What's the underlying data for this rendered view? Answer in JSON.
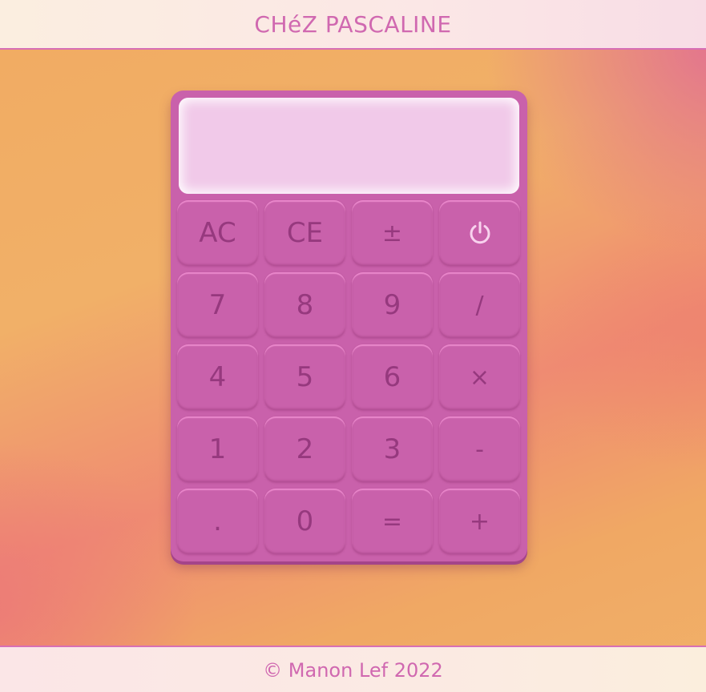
{
  "header": {
    "title": "CHéZ PASCALINE"
  },
  "calculator": {
    "display": "",
    "keys": [
      {
        "label": "AC",
        "name": "all-clear-button"
      },
      {
        "label": "CE",
        "name": "clear-entry-button"
      },
      {
        "label": "±",
        "name": "plus-minus-button"
      },
      {
        "label": "",
        "name": "power-button",
        "icon": "power-icon"
      },
      {
        "label": "7",
        "name": "digit-7-button"
      },
      {
        "label": "8",
        "name": "digit-8-button"
      },
      {
        "label": "9",
        "name": "digit-9-button"
      },
      {
        "label": "/",
        "name": "divide-button"
      },
      {
        "label": "4",
        "name": "digit-4-button"
      },
      {
        "label": "5",
        "name": "digit-5-button"
      },
      {
        "label": "6",
        "name": "digit-6-button"
      },
      {
        "label": "×",
        "name": "multiply-button"
      },
      {
        "label": "1",
        "name": "digit-1-button"
      },
      {
        "label": "2",
        "name": "digit-2-button"
      },
      {
        "label": "3",
        "name": "digit-3-button"
      },
      {
        "label": "-",
        "name": "subtract-button"
      },
      {
        "label": ".",
        "name": "decimal-point-button"
      },
      {
        "label": "0",
        "name": "digit-0-button"
      },
      {
        "label": "=",
        "name": "equals-button"
      },
      {
        "label": "+",
        "name": "add-button"
      }
    ]
  },
  "footer": {
    "copyright": "© Manon Lef 2022"
  },
  "colors": {
    "accent": "#d068b0",
    "calculator_body": "#c961ab",
    "display_bg": "#f1c9e9",
    "key_text": "#96397e"
  }
}
